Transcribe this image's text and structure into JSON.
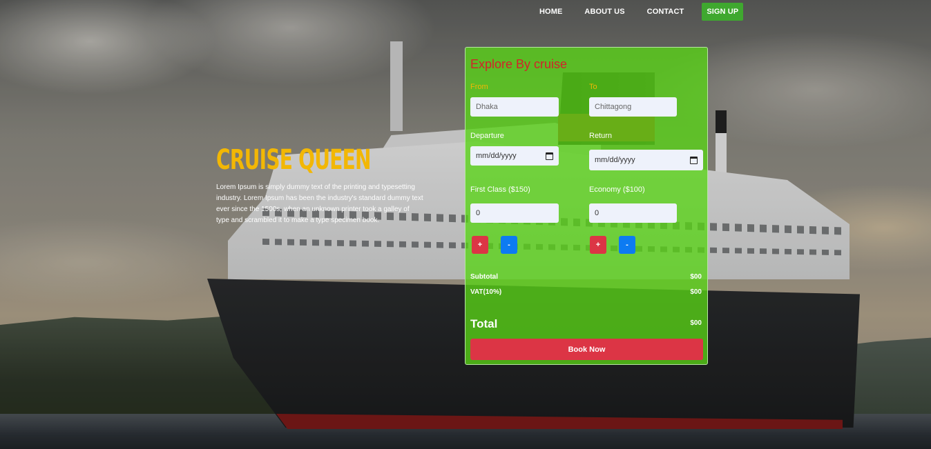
{
  "nav": {
    "home": "HOME",
    "about": "ABOUT US",
    "contact": "CONTACT",
    "signup": "SIGN UP"
  },
  "hero": {
    "title": "CRUISE QUEEN",
    "description": "Lorem Ipsum is simply dummy text of the printing and typesetting industry. Lorem Ipsum has been the industry's standard dummy text ever since the 1500s, when an unknown printer took a galley of type and scrambled it to make a type specimen book."
  },
  "booking": {
    "title": "Explore By cruise",
    "from_label": "From",
    "from_placeholder": "Dhaka",
    "to_label": "To",
    "to_placeholder": "Chittagong",
    "departure_label": "Departure",
    "departure_value": "mm/dd/yyyy",
    "return_label": "Return",
    "return_value": "mm/dd/yyyy",
    "first_class_label": "First Class ($150)",
    "first_class_qty": "0",
    "economy_label": "Economy ($100)",
    "economy_qty": "0",
    "plus": "+",
    "minus": "-",
    "subtotal_label": "Subtotal",
    "subtotal_value": "$00",
    "vat_label": "VAT(10%)",
    "vat_value": "$00",
    "total_label": "Total",
    "total_value": "$00",
    "book_button": "Book Now"
  },
  "colors": {
    "accent_yellow": "#f2b705",
    "panel_green": "#58d416",
    "danger_red": "#dc3545",
    "primary_blue": "#0d7bf2",
    "signup_green": "#3fa82f"
  }
}
